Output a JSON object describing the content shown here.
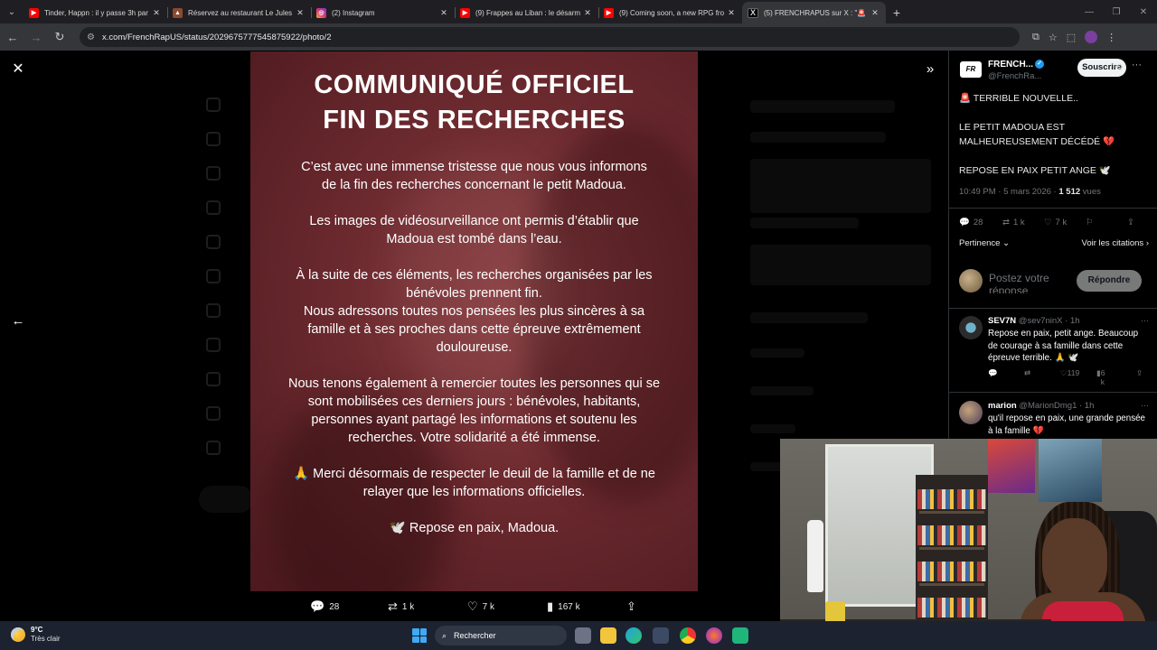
{
  "browser": {
    "tabs": [
      {
        "title": "Tinder, Happn : il y passe 3h par",
        "favicon": "youtube-icon",
        "active": false
      },
      {
        "title": "Réservez au restaurant Le Jules",
        "favicon": "restaurant-icon",
        "active": false
      },
      {
        "title": "(2) Instagram",
        "favicon": "instagram-icon",
        "active": false
      },
      {
        "title": "(9) Frappes au Liban : le désarm",
        "favicon": "youtube-icon",
        "active": false
      },
      {
        "title": "(9) Coming soon, a new RPG fro",
        "favicon": "youtube-icon",
        "active": false
      },
      {
        "title": "(5) FRENCHRAPUS sur X : \"🚨",
        "favicon": "x-icon",
        "active": true
      }
    ],
    "url": "x.com/FrenchRapUS/status/2029675777545875922/photo/2"
  },
  "photo": {
    "title_line1": "COMMUNIQUÉ OFFICIEL",
    "title_line2": "FIN DES RECHERCHES",
    "paragraphs": [
      "C’est avec une immense tristesse que nous vous informons de la fin des recherches concernant le petit Madoua.",
      "Les images de vidéosurveillance ont permis d’établir que Madoua est tombé dans l’eau.",
      "À la suite de ces éléments, les recherches organisées par les bénévoles prennent fin.",
      "Nous adressons toutes nos pensées les plus sincères à sa famille et à ses proches dans cette épreuve extrêmement douloureuse.",
      "Nous tenons également à remercier toutes les personnes qui se sont mobilisées ces derniers jours : bénévoles, habitants, personnes ayant partagé les informations et soutenu les recherches. Votre solidarité a été immense.",
      "🙏 Merci désormais de respecter le deuil de la famille et de ne relayer que les informations officielles.",
      "🕊️ Repose en paix, Madoua."
    ]
  },
  "viewer_actions": {
    "replies": "28",
    "reposts": "1 k",
    "likes": "7 k",
    "views": "167 k"
  },
  "tweet": {
    "author_name": "FRENCH...",
    "author_handle": "@FrenchRa...",
    "logo_text": "FR",
    "subscribe_label": "Souscrire",
    "text_lines": [
      "🚨 TERRIBLE NOUVELLE..",
      "LE PETIT MADOUA EST MALHEUREUSEMENT DÉCÉDÉ 💔",
      "REPOSE EN PAIX PETIT ANGE 🕊️"
    ],
    "time": "10:49 PM · 5 mars 2026 · ",
    "views_count": "1 512",
    "views_label": " vues",
    "stats": {
      "replies": "28",
      "reposts": "1 k",
      "likes": "7 k"
    },
    "sort_label": "Pertinence",
    "quotes_label": "Voir les citations",
    "reply_placeholder": "Postez votre réponse",
    "reply_button": "Répondre"
  },
  "comments": [
    {
      "name": "SEV7N",
      "handle": "@sev7ninX · 1h",
      "text": "Repose en paix, petit ange. Beaucoup de courage à sa famille dans cette épreuve terrible. 🙏 🕊️",
      "likes": "119",
      "views": "6 k"
    },
    {
      "name": "marion",
      "handle": "@MarionDmg1 · 1h",
      "text": "qu'il repose en paix, une grande pensée à la famille 💔",
      "likes": "",
      "views": ""
    }
  ],
  "taskbar": {
    "temperature": "9°C",
    "weather": "Très clair",
    "search_label": "Rechercher"
  },
  "colors": {
    "x_blue": "#1d9bf0",
    "photo_bg": "#6c2a2f",
    "taskbar_bg": "#1c2230"
  }
}
